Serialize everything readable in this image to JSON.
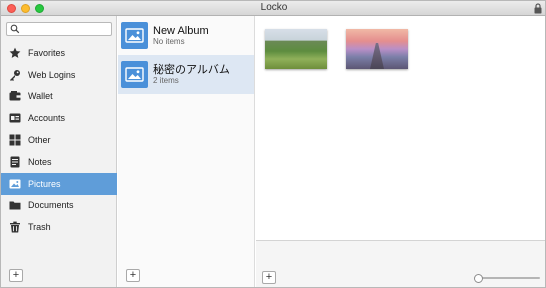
{
  "window": {
    "title": "Locko"
  },
  "sidebar": {
    "search": {
      "placeholder": ""
    },
    "items": [
      {
        "label": "Favorites",
        "icon": "star-icon"
      },
      {
        "label": "Web Logins",
        "icon": "key-icon"
      },
      {
        "label": "Wallet",
        "icon": "wallet-icon"
      },
      {
        "label": "Accounts",
        "icon": "accounts-icon"
      },
      {
        "label": "Other",
        "icon": "grid-icon"
      },
      {
        "label": "Notes",
        "icon": "notes-icon"
      },
      {
        "label": "Pictures",
        "icon": "pictures-icon",
        "selected": true
      },
      {
        "label": "Documents",
        "icon": "folder-icon"
      },
      {
        "label": "Trash",
        "icon": "trash-icon"
      }
    ],
    "add_label": "+"
  },
  "albums": {
    "items": [
      {
        "name": "New Album",
        "count": "No items"
      },
      {
        "name": "秘密のアルバム",
        "count": "2 items",
        "selected": true
      }
    ],
    "add_label": "+"
  },
  "photos": {
    "items": [
      {
        "name": "green-hills-photo"
      },
      {
        "name": "sunset-pier-photo"
      }
    ],
    "add_label": "+",
    "zoom": 0
  },
  "colors": {
    "accent": "#5f9dd9",
    "album_icon": "#4a90d9",
    "selected_album": "#dde7f3"
  }
}
